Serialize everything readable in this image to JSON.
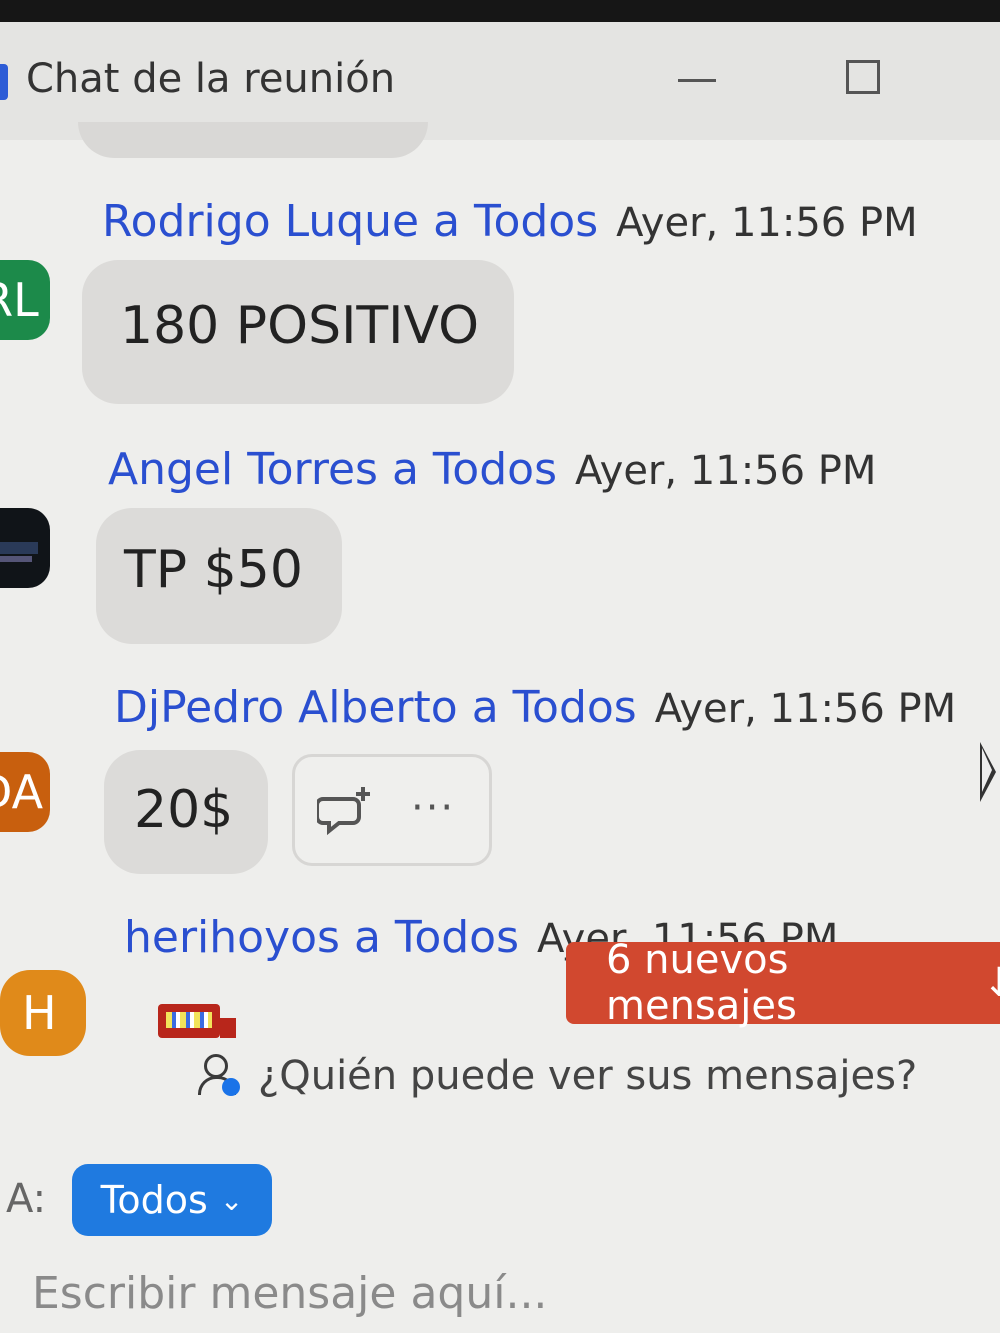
{
  "window": {
    "title": "Chat de la reunión"
  },
  "messages": [
    {
      "name": "Rodrigo Luque",
      "to": "a Todos",
      "time": "Ayer, 11:56 PM",
      "avatar": "RL",
      "text": "180 POSITIVO"
    },
    {
      "name": "Angel Torres",
      "to": "a Todos",
      "time": "Ayer, 11:56 PM",
      "avatar": "",
      "text": "TP $50"
    },
    {
      "name": "DjPedro Alberto",
      "to": "a Todos",
      "time": "Ayer, 11:56 PM",
      "avatar": "DA",
      "text": "20$"
    },
    {
      "name": "herihoyos",
      "to": "a Todos",
      "time": "Ayer, 11:56 PM",
      "avatar": "H",
      "text": ""
    }
  ],
  "actions": {
    "more": "···"
  },
  "banner": {
    "label": "6 nuevos mensajes",
    "arrow": "↓"
  },
  "privacy": {
    "label": "¿Quién puede ver sus mensajes?"
  },
  "composer": {
    "to_label": "A:",
    "recipient": "Todos",
    "placeholder": "Escribir mensaje aquí..."
  },
  "colors": {
    "sender": "#2a4fd0",
    "banner": "#d1482f",
    "recipient_button": "#1f7ae0"
  }
}
